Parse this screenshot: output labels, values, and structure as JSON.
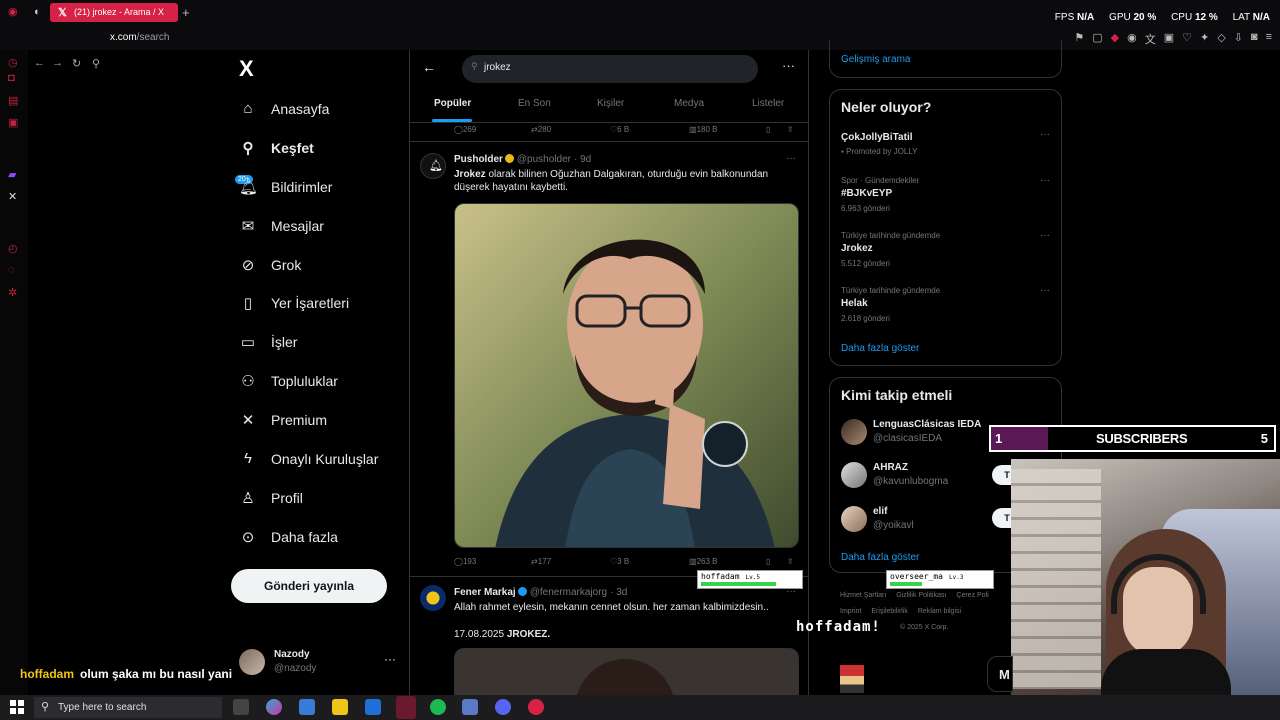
{
  "browser": {
    "tab_title": "(21) jrokez - Arama / X",
    "tab_icon": "x-logo-icon",
    "new_tab": "+",
    "url_domain": "x.com",
    "url_path": "/search",
    "stats": {
      "fps_label": "FPS",
      "fps_value": "N/A",
      "gpu_label": "GPU",
      "gpu_value": "20 %",
      "cpu_label": "CPU",
      "cpu_value": "12 %",
      "lat_label": "LAT",
      "lat_value": "N/A"
    }
  },
  "nav": {
    "brand": "X",
    "items": [
      {
        "label": "Anasayfa",
        "icon": "home-icon"
      },
      {
        "label": "Keşfet",
        "icon": "search-icon"
      },
      {
        "label": "Bildirimler",
        "icon": "bell-icon"
      },
      {
        "label": "Mesajlar",
        "icon": "mail-icon"
      },
      {
        "label": "Grok",
        "icon": "grok-icon"
      },
      {
        "label": "Yer İşaretleri",
        "icon": "bookmark-icon"
      },
      {
        "label": "İşler",
        "icon": "briefcase-icon"
      },
      {
        "label": "Topluluklar",
        "icon": "people-icon"
      },
      {
        "label": "Premium",
        "icon": "x-logo-icon"
      },
      {
        "label": "Onaylı Kuruluşlar",
        "icon": "lightning-icon"
      },
      {
        "label": "Profil",
        "icon": "person-icon"
      },
      {
        "label": "Daha fazla",
        "icon": "more-circle-icon"
      }
    ],
    "notif_badge": "20+",
    "post_button": "Gönderi yayınla",
    "account_name": "Nazody",
    "account_handle": "@nazody"
  },
  "search": {
    "query": "jrokez",
    "tabs": [
      "Popüler",
      "En Son",
      "Kişiler",
      "Medya",
      "Listeler"
    ]
  },
  "tweets": [
    {
      "stats": {
        "replies": "269",
        "retweets": "280",
        "likes": "6 B",
        "views": "180 B"
      }
    },
    {
      "author": "Pusholder",
      "handle": "@pusholder",
      "time": "· 9d",
      "text_bold": "Jrokez",
      "text": " olarak bilinen Oğuzhan Dalgakıran, oturduğu evin balkonundan düşerek hayatını kaybetti.",
      "stats": {
        "replies": "193",
        "retweets": "177",
        "likes": "3 B",
        "views": "263 B"
      }
    },
    {
      "author": "Fener Markaj",
      "handle": "@fenermarkajorg",
      "time": "· 3d",
      "text": "Allah rahmet eylesin, mekanın cennet olsun. her zaman kalbimizdesin..",
      "text2": "17.08.2025 ",
      "text2_bold": "JROKEZ."
    }
  ],
  "right": {
    "advanced_search": "Gelişmiş arama",
    "trends_title": "Neler oluyor?",
    "trends": [
      {
        "meta": "Promoted by JOLLY",
        "title": "ÇokJollyBiTatil"
      },
      {
        "meta": "Spor · Gündemdekiler",
        "title": "#BJKvEYP",
        "count": "6.963 gönderi"
      },
      {
        "meta": "Türkiye tarihinde gündemde",
        "title": "Jrokez",
        "count": "5.512 gönderi"
      },
      {
        "meta": "Türkiye tarihinde gündemde",
        "title": "Helak",
        "count": "2.618 gönderi"
      }
    ],
    "show_more": "Daha fazla göster",
    "who_title": "Kimi takip etmeli",
    "who": [
      {
        "name": "LenguasClásicas IEDA",
        "handle": "@clasicasIEDA"
      },
      {
        "name": "AHRAZ",
        "handle": "@kavunlubogma"
      },
      {
        "name": "elif",
        "handle": "@yoikavl"
      }
    ],
    "follow_label": "T",
    "show_more2": "Daha fazla göster",
    "footer": [
      "Hizmet Şartları",
      "Gizlilik Politikası",
      "Çerez Poli",
      "Imprint",
      "Erişilebilirlik",
      "Reklam bilgisi",
      "© 2025 X Corp."
    ]
  },
  "overlay": {
    "subs_current": "1",
    "subs_label": "SUBSCRIBERS",
    "subs_goal": "5",
    "subs_progress": 0.2,
    "chat_user": "hoffadam",
    "chat_message": "olum şaka mı bu nasıl yani",
    "tag1_name": "hoffadam",
    "tag1_level": "Lv.5",
    "tag2_name": "overseer_ma",
    "tag2_level": "Lv.3",
    "float_text": "hoffadam!",
    "m_label": "M"
  },
  "taskbar": {
    "search_placeholder": "Type here to search"
  }
}
